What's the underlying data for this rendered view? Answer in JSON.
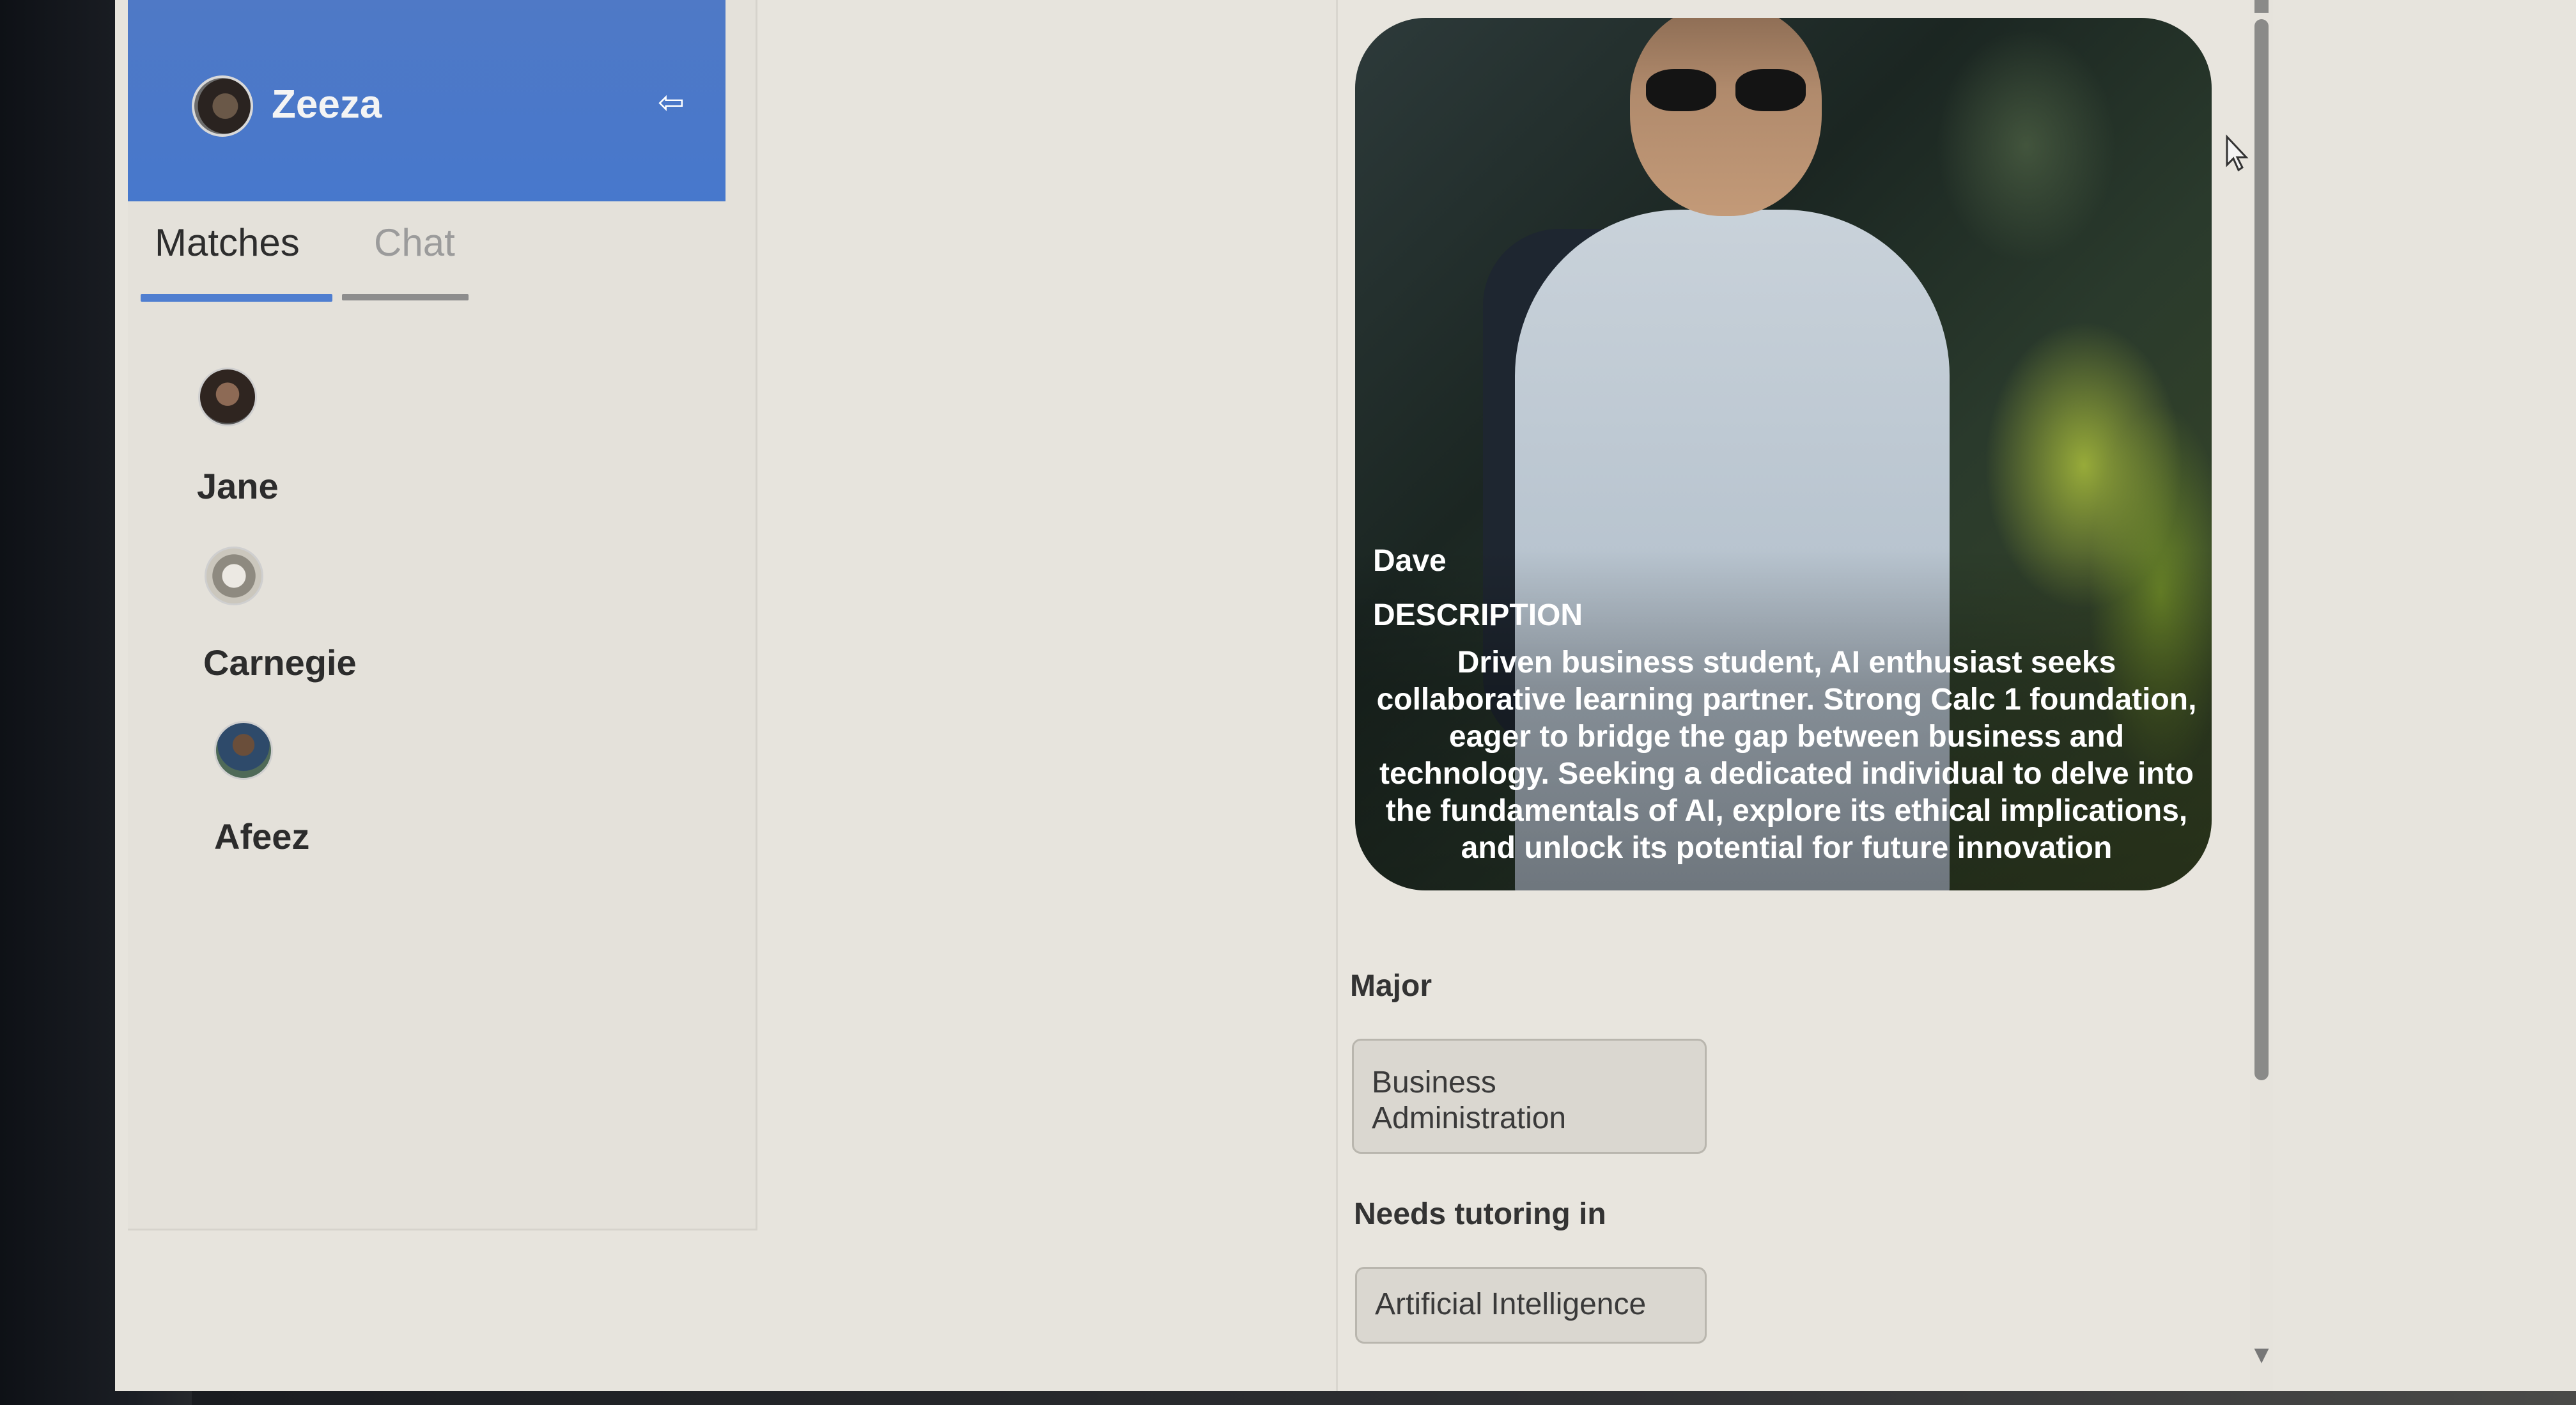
{
  "sidebar": {
    "user": {
      "name": "Zeeza",
      "avatar_icon": "user-avatar",
      "logout_icon": "logout-icon"
    },
    "tabs": [
      {
        "label": "Matches",
        "active": true
      },
      {
        "label": "Chat",
        "active": false
      }
    ],
    "matches": [
      {
        "name": "Jane"
      },
      {
        "name": "Carnegie"
      },
      {
        "name": "Afeez"
      }
    ]
  },
  "profile": {
    "name": "Dave",
    "description_label": "DESCRIPTION",
    "description": "Driven business student, AI enthusiast seeks collaborative learning partner. Strong Calc 1 foundation, eager to bridge the gap between business and technology. Seeking a dedicated individual to delve into the fundamentals of AI, explore its ethical implications, and unlock its potential for future innovation",
    "major_label": "Major",
    "major": "Business Administration",
    "tutoring_label": "Needs tutoring in",
    "tutoring": "Artificial Intelligence"
  },
  "colors": {
    "header_blue": "#4778cc",
    "tab_active_underline": "#4f7ed0",
    "chip_background": "#dad7d0"
  }
}
